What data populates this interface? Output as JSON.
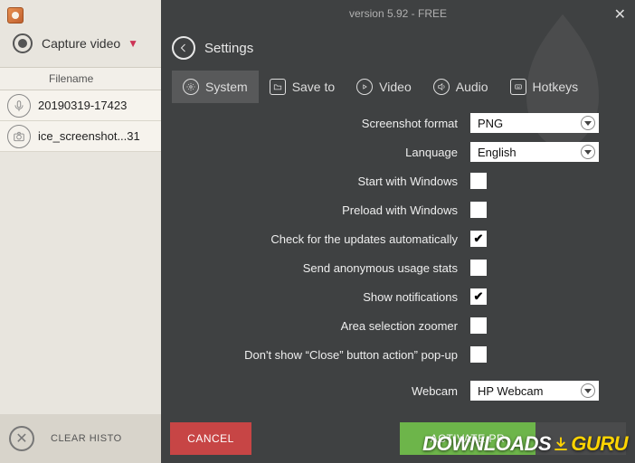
{
  "sidebar": {
    "capture_label": "Capture video",
    "file_header": "Filename",
    "files": [
      {
        "name": "20190319-17423"
      },
      {
        "name": "ice_screenshot...31"
      }
    ],
    "clear_label": "CLEAR HISTO"
  },
  "overlay": {
    "version": "version 5.92 - FREE",
    "title": "Settings",
    "tabs": [
      {
        "label": "System"
      },
      {
        "label": "Save to"
      },
      {
        "label": "Video"
      },
      {
        "label": "Audio"
      },
      {
        "label": "Hotkeys"
      }
    ],
    "rows": {
      "screenshot_format": {
        "label": "Screenshot format",
        "value": "PNG"
      },
      "language": {
        "label": "Lanquage",
        "value": "English"
      },
      "start_windows": {
        "label": "Start with Windows",
        "checked": false
      },
      "preload_windows": {
        "label": "Preload with Windows",
        "checked": false
      },
      "check_updates": {
        "label": "Check for the updates automatically",
        "checked": true
      },
      "anon_stats": {
        "label": "Send anonymous usage stats",
        "checked": false
      },
      "notifications": {
        "label": "Show notifications",
        "checked": true
      },
      "area_zoomer": {
        "label": "Area selection zoomer",
        "checked": false
      },
      "close_popup": {
        "label": "Don't show “Close” button action” pop-up",
        "checked": false
      },
      "webcam": {
        "label": "Webcam",
        "value": "HP Webcam"
      }
    },
    "buttons": {
      "cancel": "CANCEL",
      "activate": "ACTIVATE PR",
      "save": "SAV"
    }
  },
  "watermark": {
    "part1": "DOWNLOADS",
    "part2": "GURU"
  }
}
